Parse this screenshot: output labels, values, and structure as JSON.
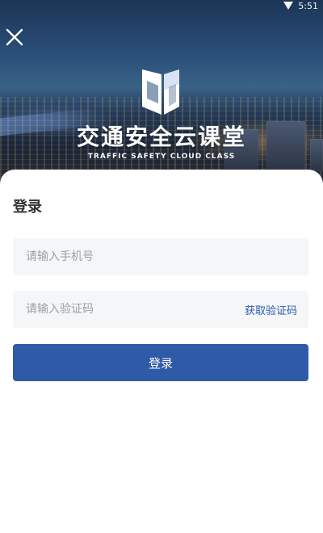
{
  "status_bar": {
    "time": "5:51",
    "signal_icon": "signal-icon"
  },
  "header": {
    "close_icon": "close-icon",
    "logo_icon": "book-logo-icon",
    "title": "交通安全云课堂",
    "subtitle": "TRAFFIC SAFETY CLOUD CLASS"
  },
  "login": {
    "title": "登录",
    "phone_placeholder": "请输入手机号",
    "phone_value": "",
    "code_placeholder": "请输入验证码",
    "code_value": "",
    "get_code_label": "获取验证码",
    "submit_label": "登录"
  },
  "colors": {
    "primary": "#2f5aa8",
    "link": "#2b5aa8",
    "field_bg": "#f5f6f8",
    "text": "#333333",
    "placeholder": "#9b9ea6"
  }
}
